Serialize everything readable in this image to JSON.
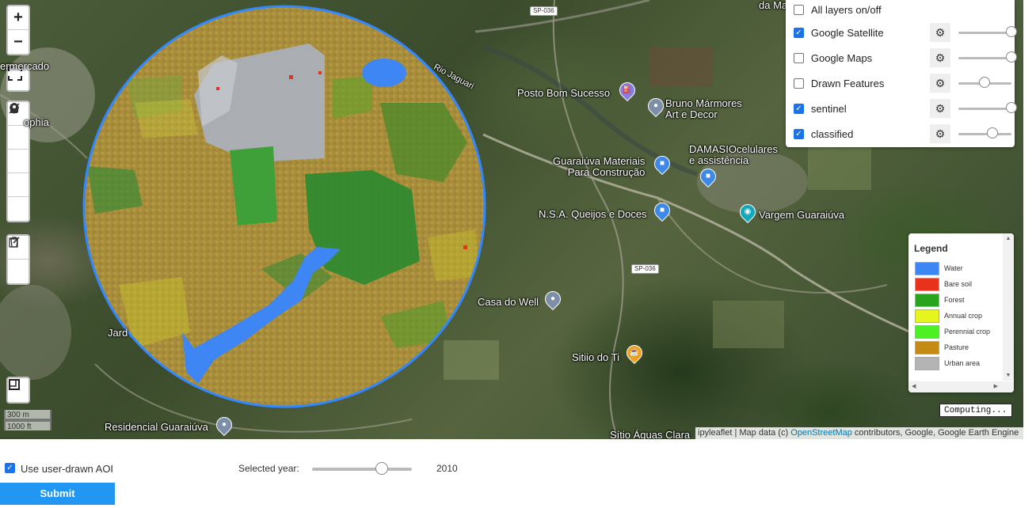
{
  "map": {
    "zoom_in": "+",
    "zoom_out": "−",
    "place_labels": [
      {
        "id": "posto",
        "text": "Posto Bom Sucesso"
      },
      {
        "id": "bruno",
        "text": "Bruno Mármores\nArt e Decor"
      },
      {
        "id": "damasio",
        "text": "DAMASIOcelulares\ne assistência"
      },
      {
        "id": "guaraiuva-mat",
        "text": "Guaraiúva Materiais\nPara Construção"
      },
      {
        "id": "nsa",
        "text": "N.S.A. Queijos e Doces"
      },
      {
        "id": "vargem",
        "text": "Vargem Guaraiúva"
      },
      {
        "id": "casa-well",
        "text": "Casa do Well"
      },
      {
        "id": "sitio-ti",
        "text": "Sitiio do Ti"
      },
      {
        "id": "residencial",
        "text": "Residencial Guaraiúva"
      },
      {
        "id": "sitio-aguas",
        "text": "Sítio Águas Clara"
      },
      {
        "id": "rio",
        "text": "Rio Jaguari"
      },
      {
        "id": "mercado",
        "text": "ermercado"
      },
      {
        "id": "sophia",
        "text": "ophia"
      },
      {
        "id": "jard",
        "text": "Jard"
      },
      {
        "id": "da-ma",
        "text": "da Ma"
      }
    ],
    "road_badges": [
      "SP-036",
      "SP-036"
    ],
    "scale_m": "300 m",
    "scale_ft": "1000 ft",
    "computing": "Computing...",
    "attribution_prefix": "ipyleaflet | Map data (c) ",
    "attribution_link": "OpenStreetMap",
    "attribution_suffix": " contributors, Google, Google Earth Engine"
  },
  "layers": {
    "all_label": "All layers on/off",
    "items": [
      {
        "label": "Google Satellite",
        "checked": true,
        "opacity": 1.0
      },
      {
        "label": "Google Maps",
        "checked": false,
        "opacity": 1.0
      },
      {
        "label": "Drawn Features",
        "checked": false,
        "opacity": 0.5
      },
      {
        "label": "sentinel",
        "checked": true,
        "opacity": 1.0
      },
      {
        "label": "classified",
        "checked": true,
        "opacity": 0.65
      }
    ]
  },
  "legend": {
    "title": "Legend",
    "items": [
      {
        "label": "Water",
        "color": "#3f86f5"
      },
      {
        "label": "Bare soil",
        "color": "#e8321c"
      },
      {
        "label": "Forest",
        "color": "#2aa41f"
      },
      {
        "label": "Annual crop",
        "color": "#e6f51d"
      },
      {
        "label": "Perennial crop",
        "color": "#4df022"
      },
      {
        "label": "Pasture",
        "color": "#c48a14"
      },
      {
        "label": "Urban area",
        "color": "#b4b4b4"
      }
    ]
  },
  "controls": {
    "use_aoi_label": "Use user-drawn AOI",
    "use_aoi_checked": true,
    "year_label": "Selected year:",
    "year_value": "2010",
    "year_position": 0.7,
    "submit_label": "Submit"
  }
}
